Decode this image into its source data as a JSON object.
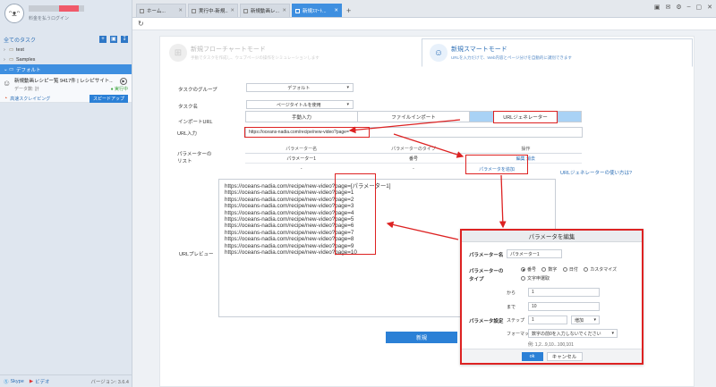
{
  "sidebar": {
    "avatar_text": "ᵔᴥᵔ",
    "user_sub": "料金を払うログイン",
    "title": "全てのタスク",
    "tree": [
      {
        "label": "test",
        "expanded": false
      },
      {
        "label": "Samples",
        "expanded": false
      },
      {
        "label": "デフォルト",
        "expanded": true
      }
    ],
    "task": {
      "title": "新規動画レシピー覧 9417件 | レシピサイト...",
      "data_label": "データ数: 計",
      "status": "● 実行中",
      "cloud": "高速スクレイピング",
      "speed_button": "スピードアップ"
    },
    "footer": {
      "skype": "Skype",
      "video": "ビデオ",
      "version": "バージョン: 3.6.4"
    }
  },
  "tabs": [
    {
      "label": "ホーム..."
    },
    {
      "label": "実行中-新規..."
    },
    {
      "label": "新規動画レ..."
    },
    {
      "label": "新規ｽﾏｰﾄ..."
    }
  ],
  "modes": {
    "flow": {
      "title": "新規フローチャートモード",
      "desc": "手動でタスクを作成し、ウェブページの操作をシミュレーションします"
    },
    "smart": {
      "title": "新規スマートモード",
      "desc": "URLを入力だけで、Web内容とページ分けを自動的に識別できます"
    }
  },
  "form": {
    "group_label": "タスクのグループ",
    "group_value": "デフォルト",
    "name_label": "タスク名",
    "name_value": "ページタイトルを使用",
    "import_label": "インポートURL",
    "import_tabs": [
      "手動入力",
      "ファイルインポート",
      "URLジェネレーター"
    ],
    "url_label": "URL入力",
    "url_value": "https://oceans-nadia.com/recipe/new-video?page=",
    "param_label": "パラメーターのリスト",
    "param_head": [
      "パラメーター名",
      "パラメーターのタイプ",
      "操作"
    ],
    "param_row": {
      "name": "パラメーター1",
      "type": "番号",
      "ops": "編集  消去"
    },
    "param_row2": {
      "name": "-",
      "type": "-"
    },
    "add_param": "パラメータを追加",
    "urlgen_help": "URLジェネレーターの使い方は?",
    "preview_label": "URLプレビュー",
    "preview_lines": [
      "https://oceans-nadia.com/recipe/new-video?page=[パラメーター1]",
      "https://oceans-nadia.com/recipe/new-video?page=1",
      "https://oceans-nadia.com/recipe/new-video?page=2",
      "https://oceans-nadia.com/recipe/new-video?page=3",
      "https://oceans-nadia.com/recipe/new-video?page=4",
      "https://oceans-nadia.com/recipe/new-video?page=5",
      "https://oceans-nadia.com/recipe/new-video?page=6",
      "https://oceans-nadia.com/recipe/new-video?page=7",
      "https://oceans-nadia.com/recipe/new-video?page=8",
      "https://oceans-nadia.com/recipe/new-video?page=9",
      "https://oceans-nadia.com/recipe/new-video?page=10"
    ],
    "create_button": "新規"
  },
  "dialog": {
    "title": "パラメータを編集",
    "name_label": "パラメーター名",
    "name_value": "パラメーター1",
    "type_label": "パラメーターのタイプ",
    "type_options": [
      "番号",
      "数字",
      "日付",
      "カスタマイズ"
    ],
    "type_extra": "文字申選取",
    "from_label": "から",
    "from_value": "1",
    "to_label": "まで",
    "to_value": "10",
    "settings_label": "パラメータ設定",
    "step_label": "ステップ",
    "step_value": "1",
    "mode_value": "増加",
    "format_label": "フォーマット",
    "format_value": "数字の前0を入力しないでください",
    "example": "例: 1,2...9,10...100,101",
    "ok": "ok",
    "cancel": "キャンセル"
  },
  "colors": {
    "accent": "#2b80d6",
    "highlight": "#dd2222",
    "active_tab": "#3e8fe0"
  }
}
